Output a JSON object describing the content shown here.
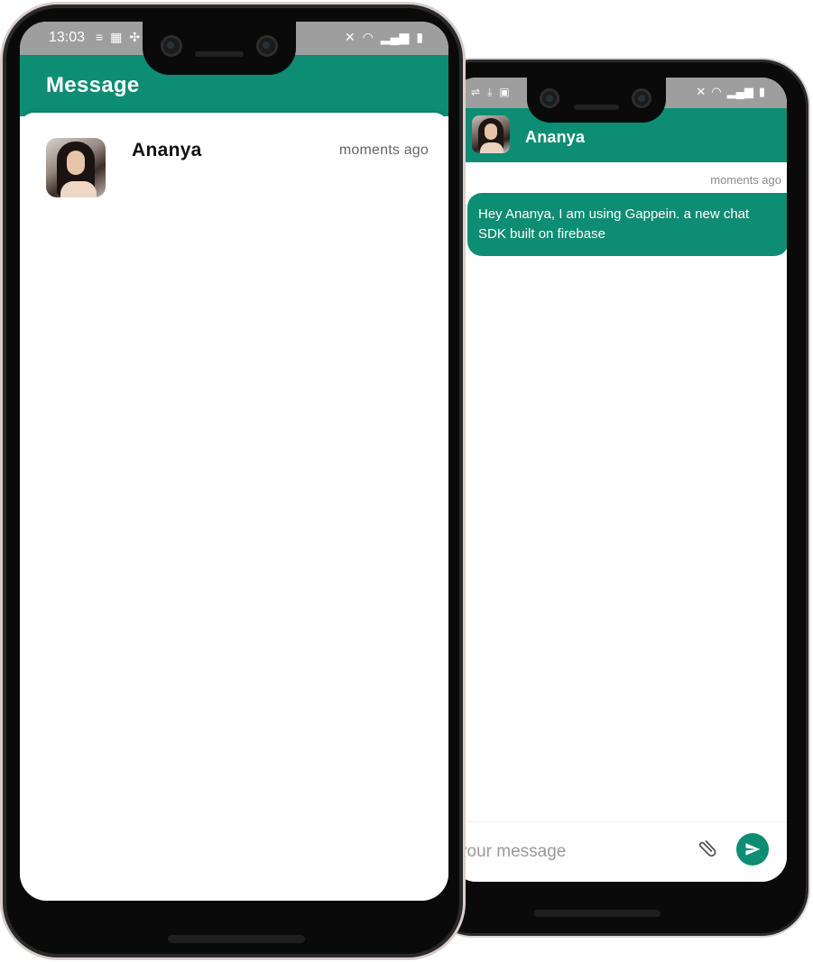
{
  "colors": {
    "primary": "#0d8d73",
    "status_bar": "#9e9e9e",
    "background": "#ffffff"
  },
  "chat_screen": {
    "status_icons_left": [
      "sliders-icon",
      "download-icon",
      "image-icon"
    ],
    "status_icons_right": [
      "mute-icon",
      "wifi-icon",
      "signal-icon",
      "battery-icon"
    ],
    "contact_name": "Ananya",
    "message": {
      "time": "moments ago",
      "text": "Hey Ananya, I am using Gappein. a new chat SDK built on firebase"
    },
    "composer": {
      "placeholder": "your message",
      "attach_icon": "paperclip-icon",
      "send_icon": "send-icon"
    }
  },
  "list_screen": {
    "status_time": "13:03",
    "status_icons_left": [
      "notification-icon",
      "calendar-icon",
      "slack-icon"
    ],
    "status_icons_right": [
      "mute-icon",
      "wifi-icon",
      "signal-icon",
      "battery-icon"
    ],
    "title": "Message",
    "conversations": [
      {
        "name": "Ananya",
        "time": "moments ago"
      }
    ]
  }
}
